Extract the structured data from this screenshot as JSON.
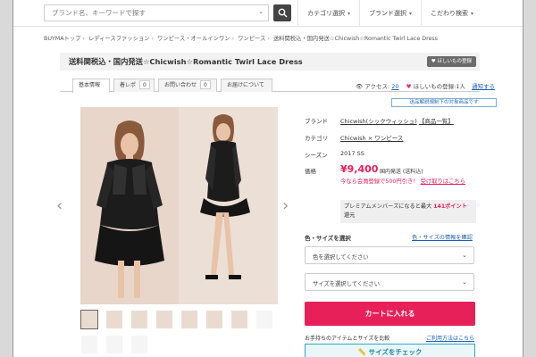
{
  "search": {
    "placeholder": "ブランド名、キーワードで探す"
  },
  "topnav": {
    "category": "カテゴリ選択",
    "brand": "ブランド選択",
    "advanced": "こだわり検索"
  },
  "breadcrumb": [
    "BUYMAトップ",
    "レディースファッション",
    "ワンピース・オールインワン",
    "ワンピース",
    "送料関税込・国内発送☆Chicwish☆Romantic Twirl Lace Dress"
  ],
  "product": {
    "title": "送料関税込・国内発送☆Chicwish☆Romantic Twirl Lace Dress",
    "fav_badge": "ほしいもの登録"
  },
  "tabs": [
    {
      "label": "基本情報",
      "count": ""
    },
    {
      "label": "着レポ",
      "count": "0"
    },
    {
      "label": "お問い合わせ",
      "count": "0"
    },
    {
      "label": "お届けについて",
      "count": ""
    }
  ],
  "stats": {
    "access_label": "アクセス:",
    "access_count": "20",
    "fav_label": "ほしいもの登録:1人",
    "fav_link": "通知する"
  },
  "notice": "送品解説規制下の対象商品です",
  "details": {
    "brand_label": "ブランド",
    "brand_value": "Chicwish(シックウィッシュ)",
    "brand_list": "【商品一覧】",
    "category_label": "カテゴリ",
    "category_value": "Chicwish × ワンピース",
    "season_label": "シーズン",
    "season_value": "2017 SS",
    "price_label": "価格",
    "price_value": "¥9,400",
    "price_note": "国内発送 (送料込)",
    "promo_text": "今なら会員登録で500円引き！",
    "promo_link": "受け取りはこちら",
    "premium_text": "プレミアムメンバーズになると最大",
    "premium_points": "141ポイント",
    "premium_suffix": "還元"
  },
  "selection": {
    "label": "色・サイズを選択",
    "help_link": "色・サイズの情報を確認",
    "color_select": "色を選択してください",
    "size_select": "サイズを選択してください"
  },
  "cart_button": "カートに入れる",
  "compare_text": "お手持ちのアイテムとサイズを比較",
  "howto_link": "ご利用方法はこちら",
  "size_check_button": "サイズをチェック",
  "colors": {
    "accent": "#e8205a",
    "link": "#1a5fb4",
    "dark": "#444444"
  }
}
